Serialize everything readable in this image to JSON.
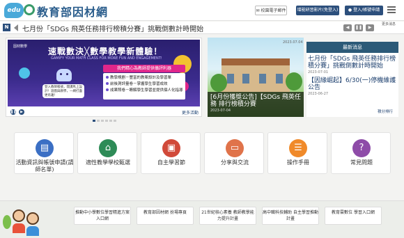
{
  "header": {
    "logo_text": "edu",
    "site_title": "教育部因材網",
    "mail_button": "校園電子郵件",
    "video_button": "增能研習影片(免登入)",
    "login_button": "登入/帳號申請",
    "menu_icon": "hamburger-menu-icon"
  },
  "ticker": {
    "badge": "N",
    "text": "七月份「SDGs 飛英任務排行榜積分賽」挑戰倒數計時開始",
    "prev_icon": "chevron-left-icon",
    "next_icon": "chevron-right-icon",
    "pause_icon": "pause-icon",
    "more_label": "更多消息"
  },
  "banner": {
    "logo_text": "因材數學",
    "title": "速戰數決╳數學教學新體驗！",
    "subtitle": "GAMIFY YOUR MATH CLASS FOR MORE FUN AND ENGAGEMENT!",
    "speech": "登入教師帳號，開課馬上設計！遊戲與教學，一網打盡更有趣！",
    "promo_head": "我們精心為教師提供儀評利器",
    "promo_lines": [
      "教學規劃－豐富的教案設計及學習單",
      "前後測評量卷－掌握學生學習成效",
      "成果照卷－瞭解學生學習並提供個人化指導"
    ],
    "more_label": "更多活動",
    "prev_icon": "pause-icon",
    "next_icon": "play-icon"
  },
  "photo_news": {
    "tag": "2023.07.04",
    "title": "[6月份獲獎公告]【SDGs 飛英任務 排行榜積分賽",
    "date": "2023-07-04"
  },
  "latest_news": {
    "heading": "最新消息",
    "items": [
      {
        "title": "七月份「SDGs 飛英任務排行榜積分賽」挑戰倒數計時開始",
        "date": "2023-07-01"
      },
      {
        "title": "【因緣崛起】6/30(一)停機維護公告",
        "date": "2023-06-27"
      }
    ],
    "more_label": "積分排行"
  },
  "tiles": [
    {
      "label": "活動資訊與帳號申請(請師名單)",
      "icon": "document-icon",
      "color": "#3b6fc4"
    },
    {
      "label": "適性教學學校甄選",
      "icon": "school-icon",
      "color": "#2e8b57"
    },
    {
      "label": "自主學習節",
      "icon": "presentation-icon",
      "color": "#d14a3a"
    },
    {
      "label": "分享與交流",
      "icon": "monitor-icon",
      "color": "#e0734a"
    },
    {
      "label": "操作手冊",
      "icon": "manual-icon",
      "color": "#f08a2a"
    },
    {
      "label": "常見問題",
      "icon": "help-icon",
      "color": "#8e4ca8"
    }
  ],
  "bottom_links": [
    "推動中小學數位學習精進方案入口網",
    "教育部因材網 扮場專頁",
    "21世紀核心素養 教師教學能力提升計畫",
    "高中職科技輔助 自主學習推動計畫",
    "教育雲數位 學習入口網"
  ]
}
